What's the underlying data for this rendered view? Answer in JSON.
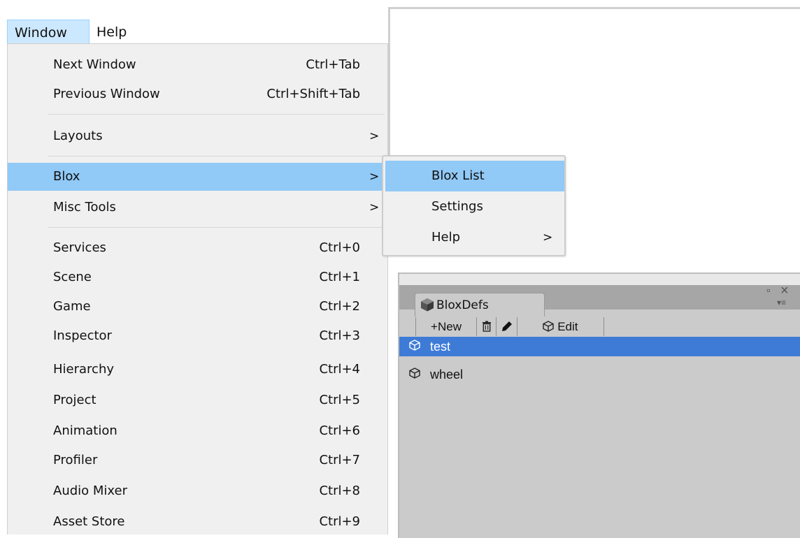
{
  "menubar": {
    "items": [
      "Window",
      "Help"
    ],
    "active_index": 0
  },
  "window_menu": {
    "items": [
      {
        "label": "Next Window",
        "shortcut": "Ctrl+Tab"
      },
      {
        "label": "Previous Window",
        "shortcut": "Ctrl+Shift+Tab"
      },
      {
        "label": "Layouts",
        "submenu_arrow": ">"
      },
      {
        "label": "Blox",
        "submenu_arrow": ">",
        "highlighted": true
      },
      {
        "label": "Misc Tools",
        "submenu_arrow": ">"
      },
      {
        "label": "Services",
        "shortcut": "Ctrl+0"
      },
      {
        "label": "Scene",
        "shortcut": "Ctrl+1"
      },
      {
        "label": "Game",
        "shortcut": "Ctrl+2"
      },
      {
        "label": "Inspector",
        "shortcut": "Ctrl+3"
      },
      {
        "label": "Hierarchy",
        "shortcut": "Ctrl+4"
      },
      {
        "label": "Project",
        "shortcut": "Ctrl+5"
      },
      {
        "label": "Animation",
        "shortcut": "Ctrl+6"
      },
      {
        "label": "Profiler",
        "shortcut": "Ctrl+7"
      },
      {
        "label": "Audio Mixer",
        "shortcut": "Ctrl+8"
      },
      {
        "label": "Asset Store",
        "shortcut": "Ctrl+9"
      }
    ]
  },
  "blox_submenu": {
    "items": [
      {
        "label": "Blox List",
        "highlighted": true
      },
      {
        "label": "Settings"
      },
      {
        "label": "Help",
        "submenu_arrow": ">"
      }
    ]
  },
  "panel": {
    "tab_label": "BloxDefs",
    "tab_icon": "cube-icon",
    "window_controls": {
      "maximize": "▫",
      "close": "×",
      "menu": "▾≡"
    },
    "toolbar": {
      "new_label": "+New",
      "delete_icon": "trash-icon",
      "rename_icon": "pencil-icon",
      "edit_label": "Edit",
      "edit_icon": "cube-outline-icon"
    },
    "list": [
      {
        "name": "test",
        "selected": true,
        "icon": "cube-outline-icon"
      },
      {
        "name": "wheel",
        "selected": false,
        "icon": "cube-outline-icon"
      }
    ]
  },
  "colors": {
    "menu_bg": "#f0f0f0",
    "menu_highlight": "#91c9f7",
    "menubar_active": "#cce8ff",
    "panel_bg": "#cbcbcb",
    "list_selection": "#3d7bd7"
  }
}
